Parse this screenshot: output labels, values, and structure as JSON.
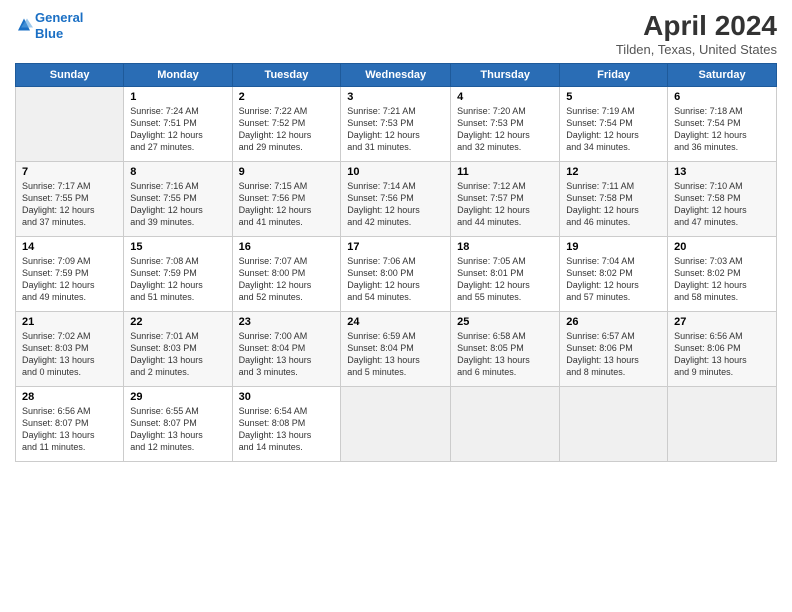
{
  "header": {
    "logo_line1": "General",
    "logo_line2": "Blue",
    "title": "April 2024",
    "subtitle": "Tilden, Texas, United States"
  },
  "days_of_week": [
    "Sunday",
    "Monday",
    "Tuesday",
    "Wednesday",
    "Thursday",
    "Friday",
    "Saturday"
  ],
  "weeks": [
    [
      {
        "day": "",
        "info": ""
      },
      {
        "day": "1",
        "info": "Sunrise: 7:24 AM\nSunset: 7:51 PM\nDaylight: 12 hours\nand 27 minutes."
      },
      {
        "day": "2",
        "info": "Sunrise: 7:22 AM\nSunset: 7:52 PM\nDaylight: 12 hours\nand 29 minutes."
      },
      {
        "day": "3",
        "info": "Sunrise: 7:21 AM\nSunset: 7:53 PM\nDaylight: 12 hours\nand 31 minutes."
      },
      {
        "day": "4",
        "info": "Sunrise: 7:20 AM\nSunset: 7:53 PM\nDaylight: 12 hours\nand 32 minutes."
      },
      {
        "day": "5",
        "info": "Sunrise: 7:19 AM\nSunset: 7:54 PM\nDaylight: 12 hours\nand 34 minutes."
      },
      {
        "day": "6",
        "info": "Sunrise: 7:18 AM\nSunset: 7:54 PM\nDaylight: 12 hours\nand 36 minutes."
      }
    ],
    [
      {
        "day": "7",
        "info": "Sunrise: 7:17 AM\nSunset: 7:55 PM\nDaylight: 12 hours\nand 37 minutes."
      },
      {
        "day": "8",
        "info": "Sunrise: 7:16 AM\nSunset: 7:55 PM\nDaylight: 12 hours\nand 39 minutes."
      },
      {
        "day": "9",
        "info": "Sunrise: 7:15 AM\nSunset: 7:56 PM\nDaylight: 12 hours\nand 41 minutes."
      },
      {
        "day": "10",
        "info": "Sunrise: 7:14 AM\nSunset: 7:56 PM\nDaylight: 12 hours\nand 42 minutes."
      },
      {
        "day": "11",
        "info": "Sunrise: 7:12 AM\nSunset: 7:57 PM\nDaylight: 12 hours\nand 44 minutes."
      },
      {
        "day": "12",
        "info": "Sunrise: 7:11 AM\nSunset: 7:58 PM\nDaylight: 12 hours\nand 46 minutes."
      },
      {
        "day": "13",
        "info": "Sunrise: 7:10 AM\nSunset: 7:58 PM\nDaylight: 12 hours\nand 47 minutes."
      }
    ],
    [
      {
        "day": "14",
        "info": "Sunrise: 7:09 AM\nSunset: 7:59 PM\nDaylight: 12 hours\nand 49 minutes."
      },
      {
        "day": "15",
        "info": "Sunrise: 7:08 AM\nSunset: 7:59 PM\nDaylight: 12 hours\nand 51 minutes."
      },
      {
        "day": "16",
        "info": "Sunrise: 7:07 AM\nSunset: 8:00 PM\nDaylight: 12 hours\nand 52 minutes."
      },
      {
        "day": "17",
        "info": "Sunrise: 7:06 AM\nSunset: 8:00 PM\nDaylight: 12 hours\nand 54 minutes."
      },
      {
        "day": "18",
        "info": "Sunrise: 7:05 AM\nSunset: 8:01 PM\nDaylight: 12 hours\nand 55 minutes."
      },
      {
        "day": "19",
        "info": "Sunrise: 7:04 AM\nSunset: 8:02 PM\nDaylight: 12 hours\nand 57 minutes."
      },
      {
        "day": "20",
        "info": "Sunrise: 7:03 AM\nSunset: 8:02 PM\nDaylight: 12 hours\nand 58 minutes."
      }
    ],
    [
      {
        "day": "21",
        "info": "Sunrise: 7:02 AM\nSunset: 8:03 PM\nDaylight: 13 hours\nand 0 minutes."
      },
      {
        "day": "22",
        "info": "Sunrise: 7:01 AM\nSunset: 8:03 PM\nDaylight: 13 hours\nand 2 minutes."
      },
      {
        "day": "23",
        "info": "Sunrise: 7:00 AM\nSunset: 8:04 PM\nDaylight: 13 hours\nand 3 minutes."
      },
      {
        "day": "24",
        "info": "Sunrise: 6:59 AM\nSunset: 8:04 PM\nDaylight: 13 hours\nand 5 minutes."
      },
      {
        "day": "25",
        "info": "Sunrise: 6:58 AM\nSunset: 8:05 PM\nDaylight: 13 hours\nand 6 minutes."
      },
      {
        "day": "26",
        "info": "Sunrise: 6:57 AM\nSunset: 8:06 PM\nDaylight: 13 hours\nand 8 minutes."
      },
      {
        "day": "27",
        "info": "Sunrise: 6:56 AM\nSunset: 8:06 PM\nDaylight: 13 hours\nand 9 minutes."
      }
    ],
    [
      {
        "day": "28",
        "info": "Sunrise: 6:56 AM\nSunset: 8:07 PM\nDaylight: 13 hours\nand 11 minutes."
      },
      {
        "day": "29",
        "info": "Sunrise: 6:55 AM\nSunset: 8:07 PM\nDaylight: 13 hours\nand 12 minutes."
      },
      {
        "day": "30",
        "info": "Sunrise: 6:54 AM\nSunset: 8:08 PM\nDaylight: 13 hours\nand 14 minutes."
      },
      {
        "day": "",
        "info": ""
      },
      {
        "day": "",
        "info": ""
      },
      {
        "day": "",
        "info": ""
      },
      {
        "day": "",
        "info": ""
      }
    ]
  ]
}
